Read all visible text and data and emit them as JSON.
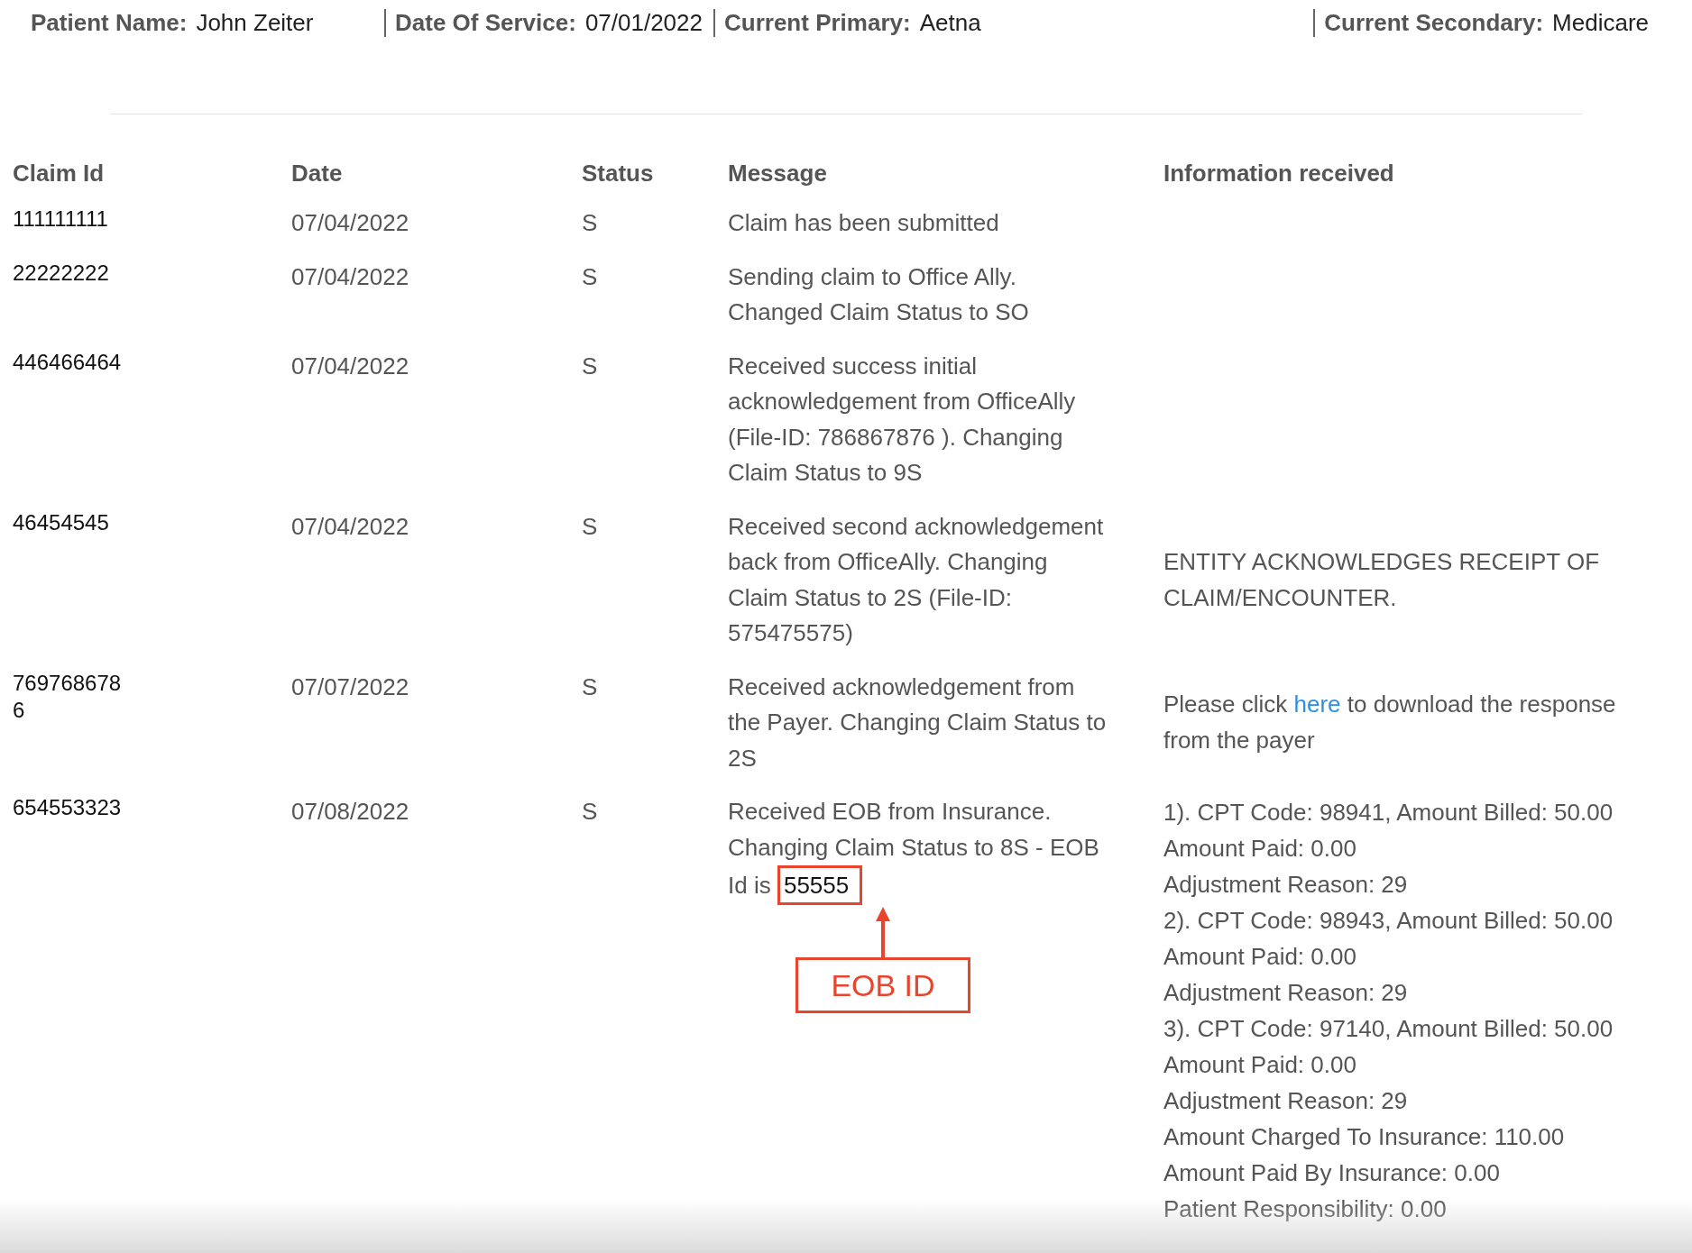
{
  "header": {
    "fields": [
      {
        "label": "Patient Name:",
        "value": "John Zeiter"
      },
      {
        "label": "Date Of Service:",
        "value": "07/01/2022"
      },
      {
        "label": "Current Primary:",
        "value": "Aetna"
      },
      {
        "label": "Current Secondary:",
        "value": "Medicare"
      }
    ]
  },
  "table": {
    "columns": [
      "Claim Id",
      "Date",
      "Status",
      "Message",
      "Information received"
    ],
    "rows": [
      {
        "claim_id": "111111111",
        "date": "07/04/2022",
        "status": "S",
        "message": "Claim has been submitted"
      },
      {
        "claim_id": "22222222",
        "date": "07/04/2022",
        "status": "S",
        "message": "Sending claim to Office Ally. Changed Claim Status to SO"
      },
      {
        "claim_id": "446466464",
        "date": "07/04/2022",
        "status": "S",
        "message": "Received success initial acknowledgement from OfficeAlly (File-ID: 786867876 ). Changing Claim Status to 9S"
      },
      {
        "claim_id": "46454545",
        "date": "07/04/2022",
        "status": "S",
        "message": "Received second acknowledgement back from OfficeAlly. Changing Claim Status to 2S (File-ID: 575475575)",
        "info": {
          "kind": "text",
          "text": "ENTITY ACKNOWLEDGES RECEIPT OF CLAIM/ENCOUNTER."
        }
      },
      {
        "claim_id": "7697686786",
        "date": "07/07/2022",
        "status": "S",
        "message": "Received acknowledgement from the Payer. Changing Claim Status to 2S",
        "info": {
          "kind": "link",
          "before": "Please click",
          "link": "here",
          "after": "to download the response from the payer"
        }
      },
      {
        "claim_id": "654553323",
        "date": "07/08/2022",
        "status": "S",
        "message": "Received EOB from Insurance. Changing Claim Status to 8S - EOB Id is",
        "eob_id": "55555",
        "annotation": "EOB ID",
        "info": {
          "kind": "lines",
          "lines": [
            "1). CPT Code: 98941, Amount Billed:  50.00",
            "Amount Paid: 0.00",
            "Adjustment Reason: 29",
            "2). CPT Code: 98943, Amount Billed:  50.00",
            "Amount Paid: 0.00",
            "Adjustment Reason: 29",
            "3). CPT Code: 97140, Amount Billed:  50.00",
            "Amount Paid: 0.00",
            "Adjustment Reason: 29",
            "Amount Charged To Insurance: 110.00",
            "Amount Paid By Insurance: 0.00",
            "Patient Responsibility: 0.00"
          ]
        }
      }
    ]
  }
}
